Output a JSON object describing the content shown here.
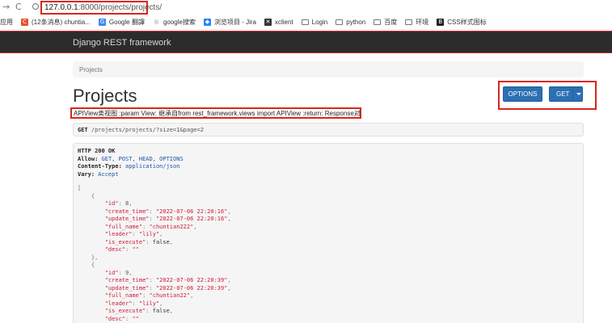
{
  "browser": {
    "url_host": "127.0.0.1",
    "url_path": ":8000/projects/projects/",
    "nav": [
      "→",
      "C"
    ],
    "bookmarks": [
      {
        "label": "应用",
        "icon": "apps-icon"
      },
      {
        "label": "(12条消息) chuntia...",
        "icon": "csdn-icon",
        "color": "#e5532d",
        "glyph": "C"
      },
      {
        "label": "Google 翻譯",
        "icon": "translate-icon",
        "color": "#4285f4",
        "glyph": "G"
      },
      {
        "label": "google搜索",
        "icon": "globe-icon",
        "color": "#888888",
        "glyph": "◎"
      },
      {
        "label": "浏览项目 - Jira",
        "icon": "jira-icon",
        "color": "#2684ff",
        "glyph": "◆"
      },
      {
        "label": "xclient",
        "icon": "xclient-icon",
        "color": "#333333",
        "glyph": "✕"
      },
      {
        "label": "Login",
        "icon": "folder-icon"
      },
      {
        "label": "python",
        "icon": "folder-icon"
      },
      {
        "label": "百度",
        "icon": "folder-icon"
      },
      {
        "label": "环境",
        "icon": "folder-icon"
      },
      {
        "label": "CSS样式图标",
        "icon": "bootstrap-icon",
        "color": "#222222",
        "glyph": "B"
      }
    ]
  },
  "navbar": {
    "brand": "Django REST framework"
  },
  "breadcrumb": {
    "item": "Projects"
  },
  "page": {
    "title": "Projects",
    "description": "APIView类视图 :param View: 继承自from rest_framework.views import APIView :return: Response对象"
  },
  "buttons": {
    "options": "OPTIONS",
    "get": "GET"
  },
  "request": {
    "method": "GET",
    "path": "/projects/projects/?size=1&page=2"
  },
  "response": {
    "status": "HTTP 200 OK",
    "headers": [
      {
        "key": "Allow:",
        "value": "GET, POST, HEAD, OPTIONS"
      },
      {
        "key": "Content-Type:",
        "value": "application/json"
      },
      {
        "key": "Vary:",
        "value": "Accept"
      }
    ],
    "items": [
      {
        "id": "8",
        "create_time": "\"2022-07-06 22:20:16\"",
        "update_time": "\"2022-07-06 22:20:16\"",
        "full_name": "\"chuntian222\"",
        "leader": "\"lily\"",
        "is_execute": "false",
        "desc": "\"\""
      },
      {
        "id": "9",
        "create_time": "\"2022-07-06 22:20:39\"",
        "update_time": "\"2022-07-06 22:20:39\"",
        "full_name": "\"chuntian22\"",
        "leader": "\"lily\"",
        "is_execute": "false",
        "desc": "\"\""
      }
    ]
  }
}
